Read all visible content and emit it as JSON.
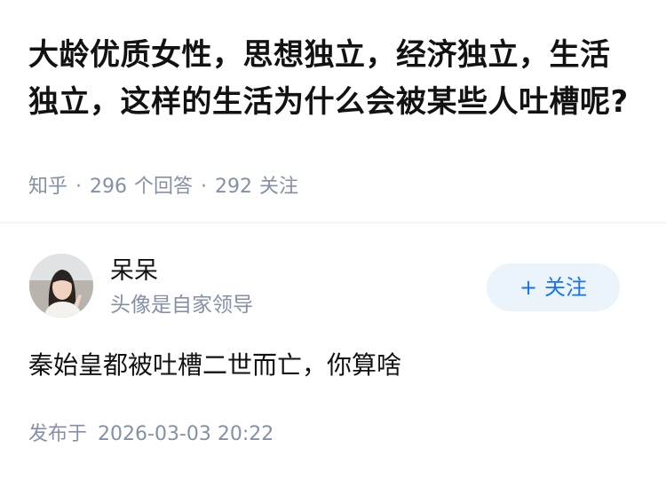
{
  "question": {
    "title": "大龄优质女性，思想独立，经济独立，生活独立，这样的生活为什么会被某些人吐槽呢?",
    "source": "知乎",
    "answer_count": "296",
    "answer_label": "个回答",
    "follower_count": "292",
    "follower_label": "关注",
    "separator": "·"
  },
  "answer": {
    "author_name": "呆呆",
    "author_bio": "头像是自家领导",
    "follow_button": {
      "icon": "+",
      "label": "关注"
    },
    "content": "秦始皇都被吐槽二世而亡，你算啥",
    "publish_label": "发布于",
    "publish_time": "2026-03-03 20:22"
  },
  "colors": {
    "text_primary": "#121212",
    "text_secondary": "#8590a6",
    "brand_blue": "#1772f6",
    "button_bg": "#ebf3fb",
    "divider": "#f3f4f6"
  }
}
